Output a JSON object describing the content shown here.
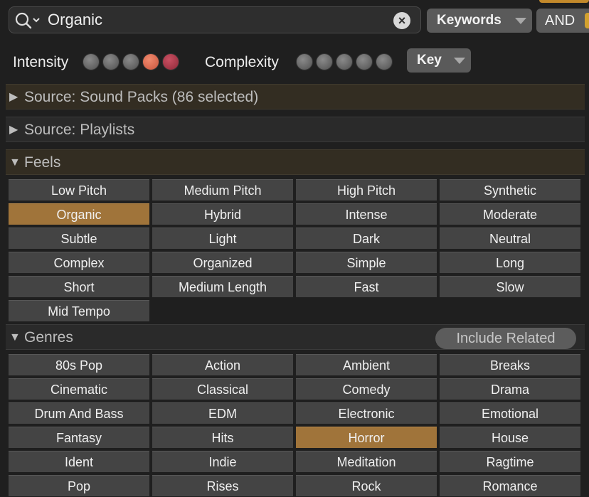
{
  "search": {
    "value": "Organic",
    "clear_icon": "×"
  },
  "keywords_label": "Keywords",
  "and_label": "AND",
  "intensity": {
    "label": "Intensity",
    "level": 4,
    "max": 5
  },
  "complexity": {
    "label": "Complexity",
    "level": 0,
    "max": 5
  },
  "key_label": "Key",
  "sections": {
    "sound_packs": "Source: Sound Packs (86 selected)",
    "playlists": "Source: Playlists",
    "feels": "Feels",
    "genres": "Genres"
  },
  "include_related": "Include Related",
  "feels": [
    {
      "label": "Low Pitch",
      "selected": false
    },
    {
      "label": "Medium Pitch",
      "selected": false
    },
    {
      "label": "High Pitch",
      "selected": false
    },
    {
      "label": "Synthetic",
      "selected": false
    },
    {
      "label": "Organic",
      "selected": true
    },
    {
      "label": "Hybrid",
      "selected": false
    },
    {
      "label": "Intense",
      "selected": false
    },
    {
      "label": "Moderate",
      "selected": false
    },
    {
      "label": "Subtle",
      "selected": false
    },
    {
      "label": "Light",
      "selected": false
    },
    {
      "label": "Dark",
      "selected": false
    },
    {
      "label": "Neutral",
      "selected": false
    },
    {
      "label": "Complex",
      "selected": false
    },
    {
      "label": "Organized",
      "selected": false
    },
    {
      "label": "Simple",
      "selected": false
    },
    {
      "label": "Long",
      "selected": false
    },
    {
      "label": "Short",
      "selected": false
    },
    {
      "label": "Medium Length",
      "selected": false
    },
    {
      "label": "Fast",
      "selected": false
    },
    {
      "label": "Slow",
      "selected": false
    },
    {
      "label": "Mid Tempo",
      "selected": false
    }
  ],
  "genres": [
    {
      "label": "80s Pop",
      "selected": false
    },
    {
      "label": "Action",
      "selected": false
    },
    {
      "label": "Ambient",
      "selected": false
    },
    {
      "label": "Breaks",
      "selected": false
    },
    {
      "label": "Cinematic",
      "selected": false
    },
    {
      "label": "Classical",
      "selected": false
    },
    {
      "label": "Comedy",
      "selected": false
    },
    {
      "label": "Drama",
      "selected": false
    },
    {
      "label": "Drum And Bass",
      "selected": false
    },
    {
      "label": "EDM",
      "selected": false
    },
    {
      "label": "Electronic",
      "selected": false
    },
    {
      "label": "Emotional",
      "selected": false
    },
    {
      "label": "Fantasy",
      "selected": false
    },
    {
      "label": "Hits",
      "selected": false
    },
    {
      "label": "Horror",
      "selected": true
    },
    {
      "label": "House",
      "selected": false
    },
    {
      "label": "Ident",
      "selected": false
    },
    {
      "label": "Indie",
      "selected": false
    },
    {
      "label": "Meditation",
      "selected": false
    },
    {
      "label": "Ragtime",
      "selected": false
    },
    {
      "label": "Pop",
      "selected": false
    },
    {
      "label": "Rises",
      "selected": false
    },
    {
      "label": "Rock",
      "selected": false
    },
    {
      "label": "Romance",
      "selected": false
    }
  ],
  "colors": {
    "selected": "#a0743a",
    "tag": "#444444",
    "intensity_on": "#e07458",
    "intensity_peak": "#b03c4c"
  }
}
